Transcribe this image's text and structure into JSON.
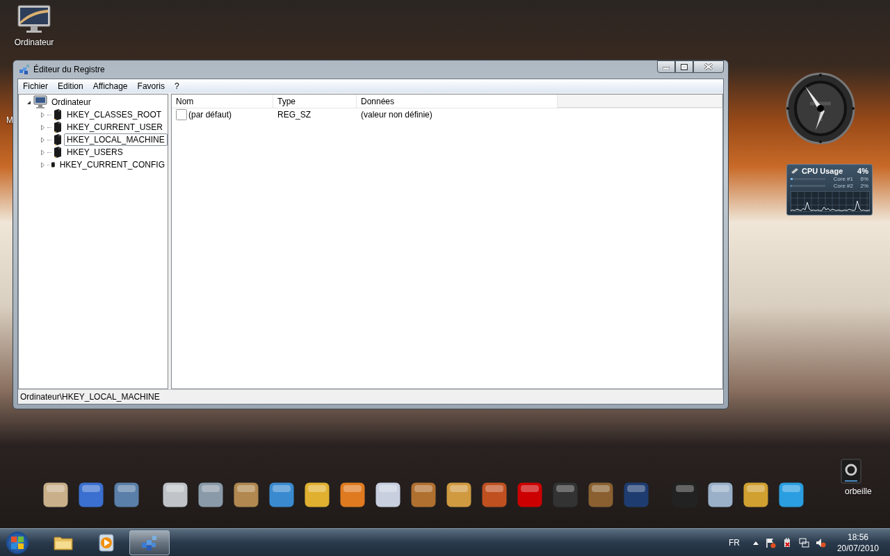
{
  "desktop_icons": [
    {
      "label": "Ordinateur",
      "kind": "computer"
    },
    {
      "label": "M",
      "kind": "hidden"
    },
    {
      "label": "orbeille",
      "kind": "bin"
    }
  ],
  "window": {
    "title": "Éditeur du Registre",
    "menu": [
      "Fichier",
      "Edition",
      "Affichage",
      "Favoris",
      "?"
    ],
    "tree": {
      "label": "Ordinateur",
      "expanded": true,
      "children": [
        {
          "label": "HKEY_CLASSES_ROOT",
          "expanded": false,
          "selected": false
        },
        {
          "label": "HKEY_CURRENT_USER",
          "expanded": false,
          "selected": false
        },
        {
          "label": "HKEY_LOCAL_MACHINE",
          "expanded": false,
          "selected": true
        },
        {
          "label": "HKEY_USERS",
          "expanded": false,
          "selected": false
        },
        {
          "label": "HKEY_CURRENT_CONFIG",
          "expanded": false,
          "selected": false
        }
      ]
    },
    "columns": [
      "Nom",
      "Type",
      "Données"
    ],
    "rows": [
      {
        "name": "(par défaut)",
        "type": "REG_SZ",
        "data": "(valeur non définie)"
      }
    ],
    "status_bar": "Ordinateur\\HKEY_LOCAL_MACHINE"
  },
  "cpu_gadget": {
    "title": "CPU Usage",
    "total": "4%",
    "cores": [
      {
        "label": "Core #1",
        "reading": "6%",
        "level": 0.06
      },
      {
        "label": "Core #2",
        "reading": "2%",
        "level": 0.02
      }
    ]
  },
  "taskbar": {
    "buttons": [
      {
        "kind": "folder",
        "selected": false
      },
      {
        "kind": "media",
        "selected": false
      },
      {
        "kind": "registry",
        "selected": true
      }
    ],
    "language": "FR",
    "time": "18:56",
    "date": "20/07/2010"
  }
}
